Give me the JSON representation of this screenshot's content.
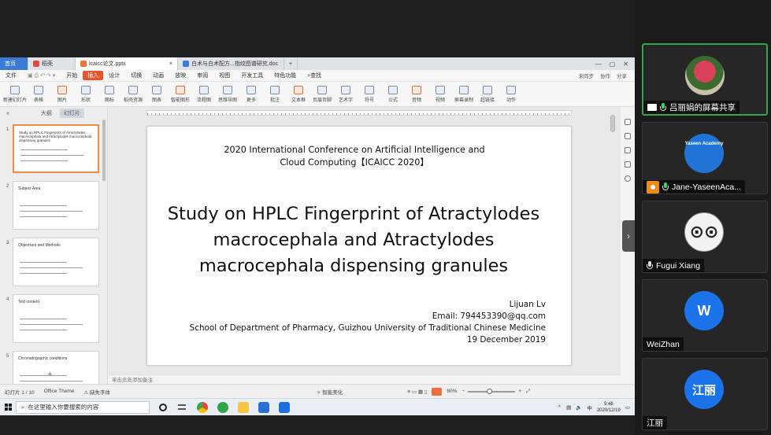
{
  "wps": {
    "tabs": [
      {
        "label": "首页"
      },
      {
        "label": "稻壳"
      },
      {
        "label": "icaicc论文.pptx"
      },
      {
        "label": "白术与白术配方...指纹图谱研究.doc"
      }
    ],
    "menu": {
      "file": "文件",
      "items": [
        "开始",
        "插入",
        "设计",
        "切换",
        "动画",
        "放映",
        "审阅",
        "视图",
        "开发工具",
        "特色功能"
      ],
      "active_index": 1,
      "search": "查找",
      "right": [
        "未同步",
        "协作",
        "分享"
      ]
    },
    "ribbon": [
      "新建幻灯片",
      "表格",
      "图片",
      "形状",
      "图标",
      "稻壳资源",
      "图表",
      "智能图形",
      "流程图",
      "思维导图",
      "更多",
      "批注",
      "文本框",
      "页眉页脚",
      "艺术字",
      "符号",
      "公式",
      "音频",
      "视频",
      "屏幕录制",
      "超链接",
      "动作"
    ],
    "left_pane": {
      "tab_outline": "大纲",
      "tab_slides": "幻灯片"
    },
    "thumbnails": [
      {
        "num": "1",
        "title": "Study on HPLC Fingerprint of Atractylodes macrocephala and Atractylodes macrocephala dispensing granules"
      },
      {
        "num": "2",
        "title": "Subject Area"
      },
      {
        "num": "3",
        "title": "Objectives and Methods"
      },
      {
        "num": "4",
        "title": "Test content"
      },
      {
        "num": "5",
        "title": "Chromatographic conditions"
      }
    ],
    "slide": {
      "conference_line1": "2020 International Conference on Artificial Intelligence and",
      "conference_line2": "Cloud Computing【ICAICC 2020】",
      "title_line1": "Study on HPLC Fingerprint of Atractylodes",
      "title_line2": "macrocephala and Atractylodes",
      "title_line3": "macrocephala dispensing granules",
      "author": "Lijuan Lv",
      "email": "Email: 794453390@qq.com",
      "affiliation": "School of Department of Pharmacy, Guizhou University of Traditional Chinese Medicine",
      "date": "19 December 2019"
    },
    "notes_placeholder": "单击此处添加备注",
    "status": {
      "slide_count": "幻灯片 1 / 10",
      "theme": "Office Theme",
      "missing_font": "缺失字体",
      "smart_beautify": "智能美化",
      "zoom": "80%"
    }
  },
  "taskbar": {
    "search_placeholder": "在这里输入你要搜索的内容",
    "time": "9:46",
    "date": "2020/12/19"
  },
  "participants": [
    {
      "name": "吕丽娟的屏幕共享",
      "avatar_text": "",
      "avatar_color": "#b73b4a",
      "mic": "on",
      "active": true
    },
    {
      "name": "Jane-YaseenAca...",
      "avatar_text": "Yaseen Academy",
      "avatar_color": "#1f74d6",
      "mic": "on",
      "active": false
    },
    {
      "name": "Fugui Xiang",
      "avatar_text": "",
      "avatar_color": "#f2f2f2",
      "mic": "off",
      "active": false
    },
    {
      "name": "WeiZhan",
      "avatar_text": "W",
      "avatar_color": "#1a73e8",
      "mic": "none",
      "active": false
    },
    {
      "name": "江丽",
      "avatar_text": "江丽",
      "avatar_color": "#1a73e8",
      "mic": "none",
      "active": false
    }
  ]
}
